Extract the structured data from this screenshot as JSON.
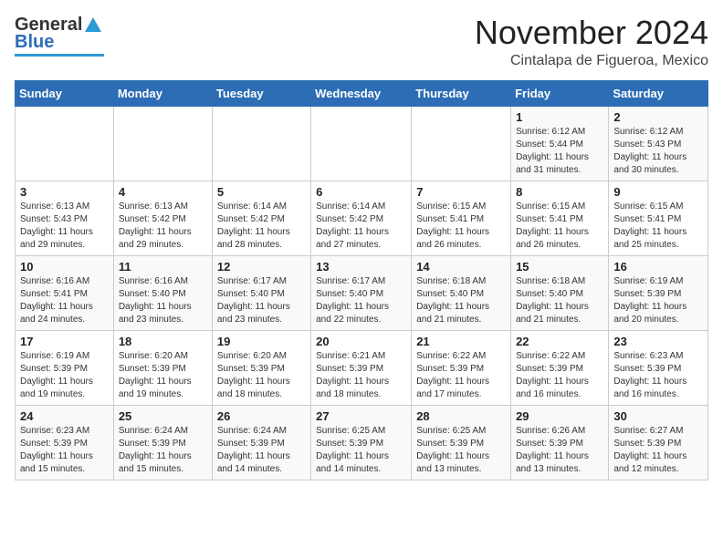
{
  "header": {
    "logo_general": "General",
    "logo_blue": "Blue",
    "month": "November 2024",
    "location": "Cintalapa de Figueroa, Mexico"
  },
  "weekdays": [
    "Sunday",
    "Monday",
    "Tuesday",
    "Wednesday",
    "Thursday",
    "Friday",
    "Saturday"
  ],
  "weeks": [
    [
      {
        "day": "",
        "info": ""
      },
      {
        "day": "",
        "info": ""
      },
      {
        "day": "",
        "info": ""
      },
      {
        "day": "",
        "info": ""
      },
      {
        "day": "",
        "info": ""
      },
      {
        "day": "1",
        "info": "Sunrise: 6:12 AM\nSunset: 5:44 PM\nDaylight: 11 hours\nand 31 minutes."
      },
      {
        "day": "2",
        "info": "Sunrise: 6:12 AM\nSunset: 5:43 PM\nDaylight: 11 hours\nand 30 minutes."
      }
    ],
    [
      {
        "day": "3",
        "info": "Sunrise: 6:13 AM\nSunset: 5:43 PM\nDaylight: 11 hours\nand 29 minutes."
      },
      {
        "day": "4",
        "info": "Sunrise: 6:13 AM\nSunset: 5:42 PM\nDaylight: 11 hours\nand 29 minutes."
      },
      {
        "day": "5",
        "info": "Sunrise: 6:14 AM\nSunset: 5:42 PM\nDaylight: 11 hours\nand 28 minutes."
      },
      {
        "day": "6",
        "info": "Sunrise: 6:14 AM\nSunset: 5:42 PM\nDaylight: 11 hours\nand 27 minutes."
      },
      {
        "day": "7",
        "info": "Sunrise: 6:15 AM\nSunset: 5:41 PM\nDaylight: 11 hours\nand 26 minutes."
      },
      {
        "day": "8",
        "info": "Sunrise: 6:15 AM\nSunset: 5:41 PM\nDaylight: 11 hours\nand 26 minutes."
      },
      {
        "day": "9",
        "info": "Sunrise: 6:15 AM\nSunset: 5:41 PM\nDaylight: 11 hours\nand 25 minutes."
      }
    ],
    [
      {
        "day": "10",
        "info": "Sunrise: 6:16 AM\nSunset: 5:41 PM\nDaylight: 11 hours\nand 24 minutes."
      },
      {
        "day": "11",
        "info": "Sunrise: 6:16 AM\nSunset: 5:40 PM\nDaylight: 11 hours\nand 23 minutes."
      },
      {
        "day": "12",
        "info": "Sunrise: 6:17 AM\nSunset: 5:40 PM\nDaylight: 11 hours\nand 23 minutes."
      },
      {
        "day": "13",
        "info": "Sunrise: 6:17 AM\nSunset: 5:40 PM\nDaylight: 11 hours\nand 22 minutes."
      },
      {
        "day": "14",
        "info": "Sunrise: 6:18 AM\nSunset: 5:40 PM\nDaylight: 11 hours\nand 21 minutes."
      },
      {
        "day": "15",
        "info": "Sunrise: 6:18 AM\nSunset: 5:40 PM\nDaylight: 11 hours\nand 21 minutes."
      },
      {
        "day": "16",
        "info": "Sunrise: 6:19 AM\nSunset: 5:39 PM\nDaylight: 11 hours\nand 20 minutes."
      }
    ],
    [
      {
        "day": "17",
        "info": "Sunrise: 6:19 AM\nSunset: 5:39 PM\nDaylight: 11 hours\nand 19 minutes."
      },
      {
        "day": "18",
        "info": "Sunrise: 6:20 AM\nSunset: 5:39 PM\nDaylight: 11 hours\nand 19 minutes."
      },
      {
        "day": "19",
        "info": "Sunrise: 6:20 AM\nSunset: 5:39 PM\nDaylight: 11 hours\nand 18 minutes."
      },
      {
        "day": "20",
        "info": "Sunrise: 6:21 AM\nSunset: 5:39 PM\nDaylight: 11 hours\nand 18 minutes."
      },
      {
        "day": "21",
        "info": "Sunrise: 6:22 AM\nSunset: 5:39 PM\nDaylight: 11 hours\nand 17 minutes."
      },
      {
        "day": "22",
        "info": "Sunrise: 6:22 AM\nSunset: 5:39 PM\nDaylight: 11 hours\nand 16 minutes."
      },
      {
        "day": "23",
        "info": "Sunrise: 6:23 AM\nSunset: 5:39 PM\nDaylight: 11 hours\nand 16 minutes."
      }
    ],
    [
      {
        "day": "24",
        "info": "Sunrise: 6:23 AM\nSunset: 5:39 PM\nDaylight: 11 hours\nand 15 minutes."
      },
      {
        "day": "25",
        "info": "Sunrise: 6:24 AM\nSunset: 5:39 PM\nDaylight: 11 hours\nand 15 minutes."
      },
      {
        "day": "26",
        "info": "Sunrise: 6:24 AM\nSunset: 5:39 PM\nDaylight: 11 hours\nand 14 minutes."
      },
      {
        "day": "27",
        "info": "Sunrise: 6:25 AM\nSunset: 5:39 PM\nDaylight: 11 hours\nand 14 minutes."
      },
      {
        "day": "28",
        "info": "Sunrise: 6:25 AM\nSunset: 5:39 PM\nDaylight: 11 hours\nand 13 minutes."
      },
      {
        "day": "29",
        "info": "Sunrise: 6:26 AM\nSunset: 5:39 PM\nDaylight: 11 hours\nand 13 minutes."
      },
      {
        "day": "30",
        "info": "Sunrise: 6:27 AM\nSunset: 5:39 PM\nDaylight: 11 hours\nand 12 minutes."
      }
    ]
  ]
}
